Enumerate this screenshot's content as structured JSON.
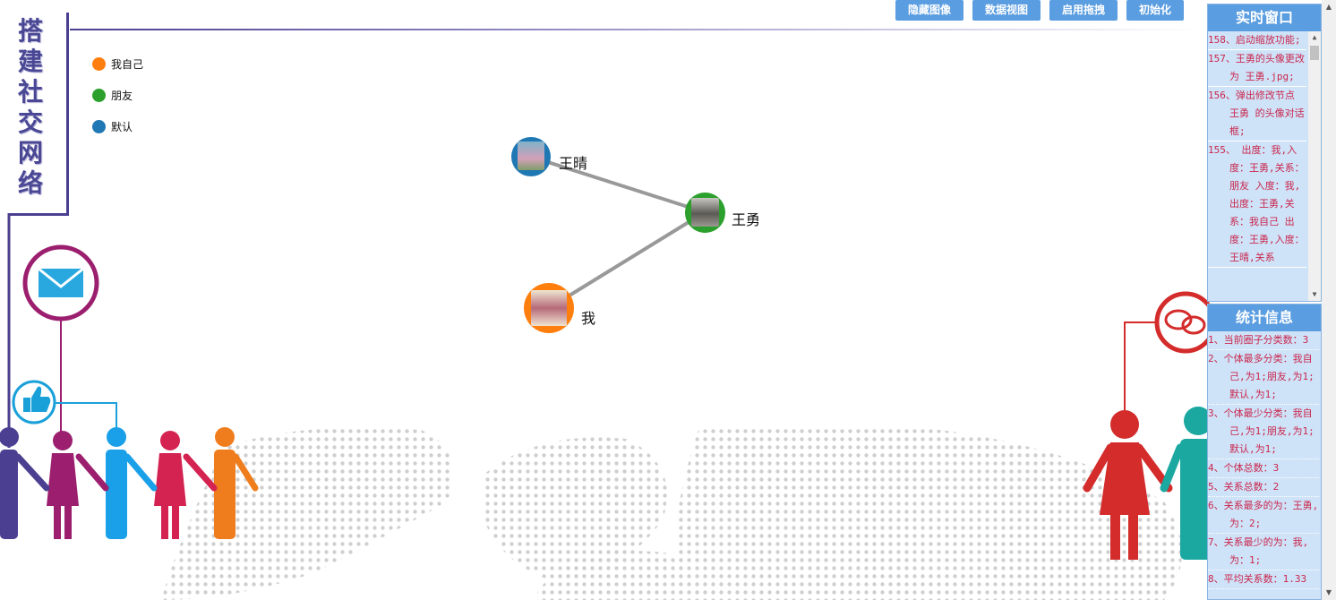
{
  "title": "搭建社交网络",
  "toolbar": {
    "hide_image": "隐藏图像",
    "data_view": "数据视图",
    "enable_drag": "启用拖拽",
    "init": "初始化"
  },
  "legend": [
    {
      "label": "我自己",
      "color": "#ff7f0e"
    },
    {
      "label": "朋友",
      "color": "#2ca02c"
    },
    {
      "label": "默认",
      "color": "#1f77b4"
    }
  ],
  "graph": {
    "nodes": [
      {
        "name": "王晴",
        "category": "默认",
        "color": "#1f77b4"
      },
      {
        "name": "王勇",
        "category": "朋友",
        "color": "#2ca02c"
      },
      {
        "name": "我",
        "category": "我自己",
        "color": "#ff7f0e"
      }
    ],
    "links": [
      {
        "source": "王晴",
        "target": "王勇"
      },
      {
        "source": "王勇",
        "target": "我"
      }
    ]
  },
  "realtime": {
    "title": "实时窗口",
    "entries": [
      "158、启动缩放功能;",
      "157、王勇的头像更改为 王勇.jpg;",
      "156、弹出修改节点 王勇 的头像对话框;",
      "155、 出度：我,入度：王勇,关系：朋友 入度：我,出度：王勇,关系：我自己 出度：王勇,入度：王晴,关系"
    ]
  },
  "stats": {
    "title": "统计信息",
    "entries": [
      "1、当前圈子分类数：3",
      "2、个体最多分类：我自己,为1;朋友,为1;默认,为1;",
      "3、个体最少分类：我自己,为1;朋友,为1;默认,为1;",
      "4、个体总数：3",
      "5、关系总数：2",
      "6、关系最多的为：王勇,为：2;",
      "7、关系最少的为：我,为：1;",
      "8、平均关系数：1.33"
    ]
  },
  "colors": {
    "accent": "#5a9de0",
    "title": "#4a4895",
    "link": "#999999"
  },
  "icons": [
    "mail-icon",
    "thumbs-up-icon",
    "chat-bubbles-icon",
    "people-figures"
  ]
}
